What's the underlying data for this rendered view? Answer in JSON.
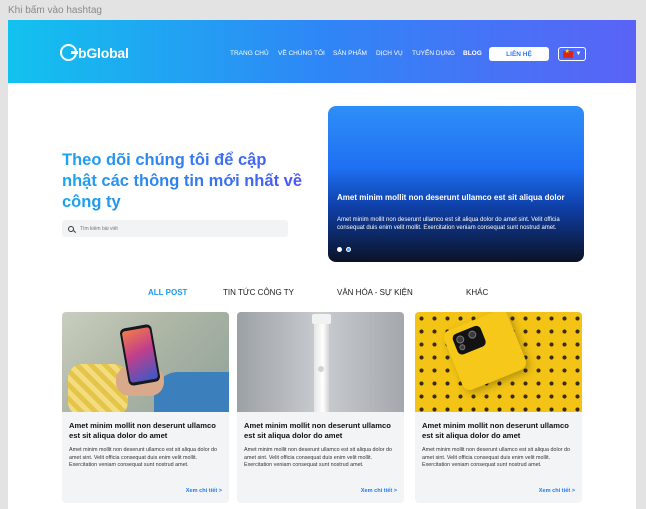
{
  "frame_label": "Khi bấm vào hashtag",
  "header": {
    "logo": "bGlobal",
    "nav": [
      {
        "label": "TRANG CHỦ",
        "active": false
      },
      {
        "label": "VỀ CHÚNG TÔI",
        "active": false
      },
      {
        "label": "SẢN PHẨM",
        "active": false
      },
      {
        "label": "DỊCH VỤ",
        "active": false
      },
      {
        "label": "TUYỂN DỤNG",
        "active": false
      },
      {
        "label": "BLOG",
        "active": true
      }
    ],
    "contact_label": "LIÊN HỆ",
    "lang_flag": "vietnam-flag-icon"
  },
  "hero": {
    "title": "Theo dõi chúng tôi để cập nhật các thông tin mới nhất về công ty",
    "search_placeholder": "Tìm kiếm bài viết"
  },
  "slider": {
    "title": "Amet minim mollit non deserunt ullamco est sit aliqua dolor",
    "text": "Amet minim mollit non deserunt ullamco est sit aliqua dolor do amet sint. Velit officia consequat duis enim velit mollit. Exercitation veniam consequat sunt nostrud amet."
  },
  "tabs": [
    {
      "label": "ALL POST",
      "active": true
    },
    {
      "label": "TIN TỨC CÔNG TY",
      "active": false
    },
    {
      "label": "VĂN HÓA - SỰ KIỆN",
      "active": false
    },
    {
      "label": "KHÁC",
      "active": false
    }
  ],
  "cards": [
    {
      "title": "Amet minim mollit non deserunt ullamco est sit aliqua dolor do amet",
      "text": "Amet minim mollit non deserunt ullamco est sit aliqua dolor do amet sint. Velit officia consequat duis enim velit mollit. Exercitation veniam consequat sunt nostrud amet.",
      "link": "Xem chi tiết >"
    },
    {
      "title": "Amet minim mollit non deserunt ullamco est sit aliqua dolor do amet",
      "text": "Amet minim mollit non deserunt ullamco est sit aliqua dolor do amet sint. Velit officia consequat duis enim velit mollit. Exercitation veniam consequat sunt nostrud amet.",
      "link": "Xem chi tiết >"
    },
    {
      "title": "Amet minim mollit non deserunt ullamco est sit aliqua dolor do amet",
      "text": "Amet minim mollit non deserunt ullamco est sit aliqua dolor do amet sint. Velit officia consequat duis enim velit mollit. Exercitation veniam consequat sunt nostrud amet.",
      "link": "Xem chi tiết >"
    }
  ]
}
